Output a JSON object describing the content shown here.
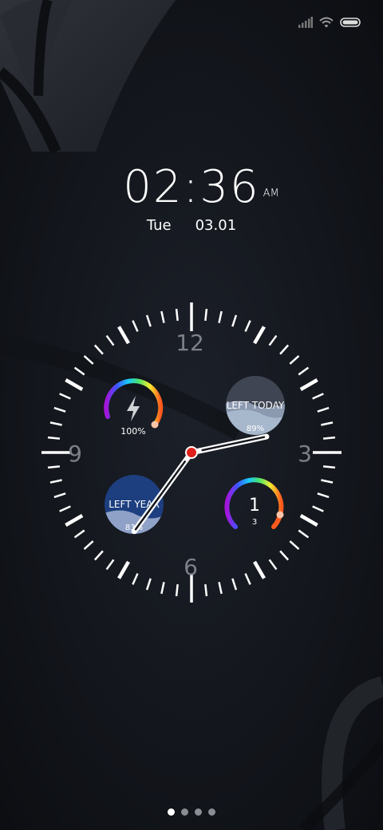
{
  "status": {
    "signal_icon": "signal-icon",
    "wifi_icon": "wifi-icon",
    "battery_icon": "battery-icon"
  },
  "clock": {
    "time": "02:36",
    "ampm": "AM",
    "day": "Tue",
    "date": "03.01",
    "hour_hand_value": 2.6,
    "minute_hand_value": 36
  },
  "dial": {
    "numerals": {
      "top": "12",
      "right": "3",
      "bottom": "6",
      "left": "9"
    }
  },
  "widgets": {
    "battery": {
      "icon": "lightning-icon",
      "value": "100%",
      "level": 1.0
    },
    "left_today": {
      "label": "LEFT TODAY",
      "value": "89%",
      "level": 0.89
    },
    "left_year": {
      "label": "LEFT YEAR",
      "value": "83%",
      "level": 0.83
    },
    "weekday": {
      "big": "1",
      "small": "3",
      "level": 0.76
    }
  },
  "colors": {
    "background": "#14171d",
    "second_hand_dot": "#e0201c",
    "left_today_fill": "#a7b7cc",
    "left_year_fill": "#1d3f80"
  },
  "pager": {
    "count": 4,
    "active": 0
  }
}
